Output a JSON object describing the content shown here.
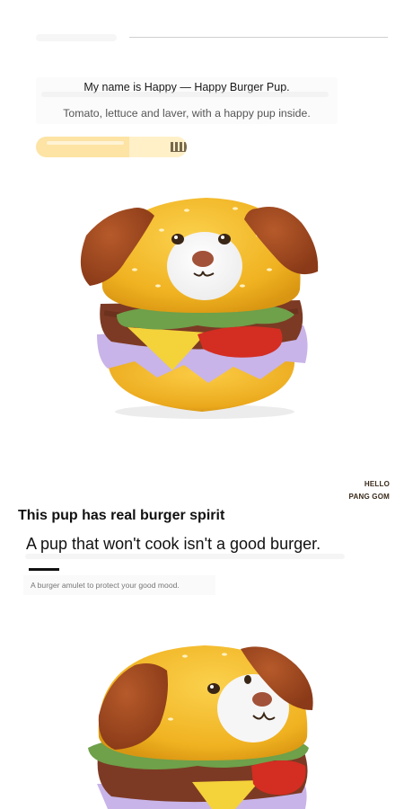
{
  "intro": {
    "name_line": "My name is Happy — Happy Burger Pup.",
    "description": "Tomato, lettuce and laver, with a happy pup inside."
  },
  "brand": {
    "line1": "HELLO",
    "line2": "PANG GOM"
  },
  "feature": {
    "title": "This pup has real burger spirit",
    "tagline": "A pup that won't cook isn't a good burger.",
    "note": "A burger amulet to protect your good mood."
  },
  "colors": {
    "bun": "#f1b522",
    "ear": "#a24a1f",
    "lettuce": "#6fa04a",
    "tomato": "#d42d22",
    "cheese": "#f4d23a",
    "lavender": "#c8b4e8",
    "patty": "#7c3a24",
    "tag_pill": "#fde3a4"
  }
}
